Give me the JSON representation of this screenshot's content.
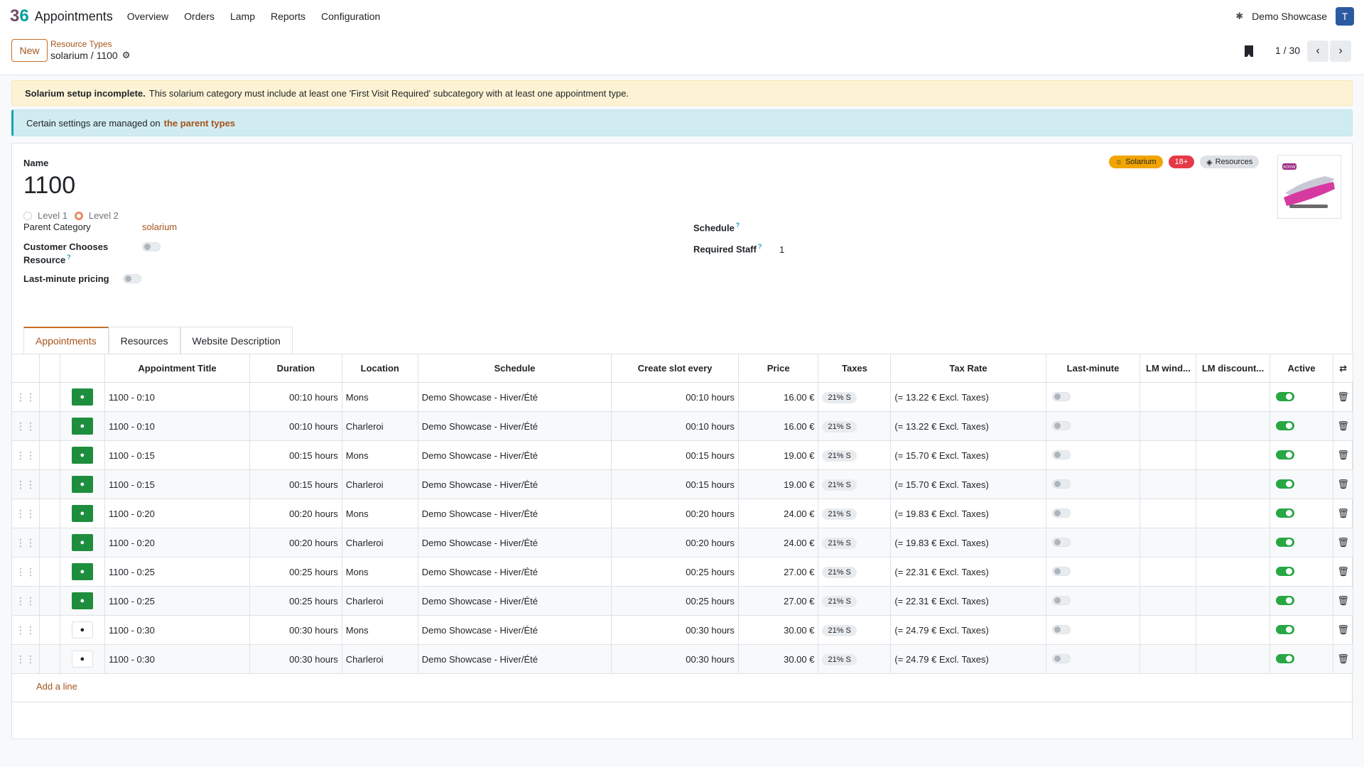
{
  "nav": {
    "app_name": "Appointments",
    "menu": [
      "Overview",
      "Orders",
      "Lamp",
      "Reports",
      "Configuration"
    ],
    "company": "Demo Showcase",
    "avatar_letter": "T"
  },
  "control_panel": {
    "new_label": "New",
    "breadcrumb_parent": "Resource Types",
    "breadcrumb_current": "solarium / 1100",
    "pager": "1 / 30"
  },
  "alerts": {
    "warning_bold": "Solarium setup incomplete.",
    "warning_text": "This solarium category must include at least one 'First Visit Required' subcategory with at least one appointment type.",
    "info_text": "Certain settings are managed on",
    "info_link": "the parent types"
  },
  "form": {
    "name_label": "Name",
    "name_value": "1100",
    "levels": [
      "Level 1",
      "Level 2"
    ],
    "tags": [
      "Solarium",
      "18+",
      "Resources"
    ],
    "parent_category_label": "Parent Category",
    "parent_category_value": "solarium",
    "customer_chooses_label_1": "Customer Chooses",
    "customer_chooses_label_2": "Resource",
    "last_minute_label": "Last-minute pricing",
    "schedule_label": "Schedule",
    "required_staff_label": "Required Staff",
    "required_staff_value": "1",
    "help_mark": "?",
    "image_badge": "600W"
  },
  "tabs": [
    "Appointments",
    "Resources",
    "Website Description"
  ],
  "table": {
    "headers": [
      "Appointment Title",
      "Duration",
      "Location",
      "Schedule",
      "Create slot every",
      "Price",
      "Taxes",
      "Tax Rate",
      "Last-minute",
      "LM wind...",
      "LM discount...",
      "Active"
    ],
    "rows": [
      {
        "title": "1100 - 0:10",
        "duration": "00:10 hours",
        "location": "Mons",
        "schedule": "Demo Showcase - Hiver/Été",
        "slot": "00:10 hours",
        "price": "16.00 €",
        "tax": "21% S",
        "rate": "(= 13.22 € Excl. Taxes)"
      },
      {
        "title": "1100 - 0:10",
        "duration": "00:10 hours",
        "location": "Charleroi",
        "schedule": "Demo Showcase - Hiver/Été",
        "slot": "00:10 hours",
        "price": "16.00 €",
        "tax": "21% S",
        "rate": "(= 13.22 € Excl. Taxes)"
      },
      {
        "title": "1100 - 0:15",
        "duration": "00:15 hours",
        "location": "Mons",
        "schedule": "Demo Showcase - Hiver/Été",
        "slot": "00:15 hours",
        "price": "19.00 €",
        "tax": "21% S",
        "rate": "(= 15.70 € Excl. Taxes)"
      },
      {
        "title": "1100 - 0:15",
        "duration": "00:15 hours",
        "location": "Charleroi",
        "schedule": "Demo Showcase - Hiver/Été",
        "slot": "00:15 hours",
        "price": "19.00 €",
        "tax": "21% S",
        "rate": "(= 15.70 € Excl. Taxes)"
      },
      {
        "title": "1100 - 0:20",
        "duration": "00:20 hours",
        "location": "Mons",
        "schedule": "Demo Showcase - Hiver/Été",
        "slot": "00:20 hours",
        "price": "24.00 €",
        "tax": "21% S",
        "rate": "(= 19.83 € Excl. Taxes)"
      },
      {
        "title": "1100 - 0:20",
        "duration": "00:20 hours",
        "location": "Charleroi",
        "schedule": "Demo Showcase - Hiver/Été",
        "slot": "00:20 hours",
        "price": "24.00 €",
        "tax": "21% S",
        "rate": "(= 19.83 € Excl. Taxes)"
      },
      {
        "title": "1100 - 0:25",
        "duration": "00:25 hours",
        "location": "Mons",
        "schedule": "Demo Showcase - Hiver/Été",
        "slot": "00:25 hours",
        "price": "27.00 €",
        "tax": "21% S",
        "rate": "(= 22.31 € Excl. Taxes)"
      },
      {
        "title": "1100 - 0:25",
        "duration": "00:25 hours",
        "location": "Charleroi",
        "schedule": "Demo Showcase - Hiver/Été",
        "slot": "00:25 hours",
        "price": "27.00 €",
        "tax": "21% S",
        "rate": "(= 22.31 € Excl. Taxes)"
      },
      {
        "title": "1100 - 0:30",
        "duration": "00:30 hours",
        "location": "Mons",
        "schedule": "Demo Showcase - Hiver/Été",
        "slot": "00:30 hours",
        "price": "30.00 €",
        "tax": "21% S",
        "rate": "(= 24.79 € Excl. Taxes)"
      },
      {
        "title": "1100 - 0:30",
        "duration": "00:30 hours",
        "location": "Charleroi",
        "schedule": "Demo Showcase - Hiver/Été",
        "slot": "00:30 hours",
        "price": "30.00 €",
        "tax": "21% S",
        "rate": "(= 24.79 € Excl. Taxes)"
      }
    ],
    "add_line": "Add a line"
  }
}
